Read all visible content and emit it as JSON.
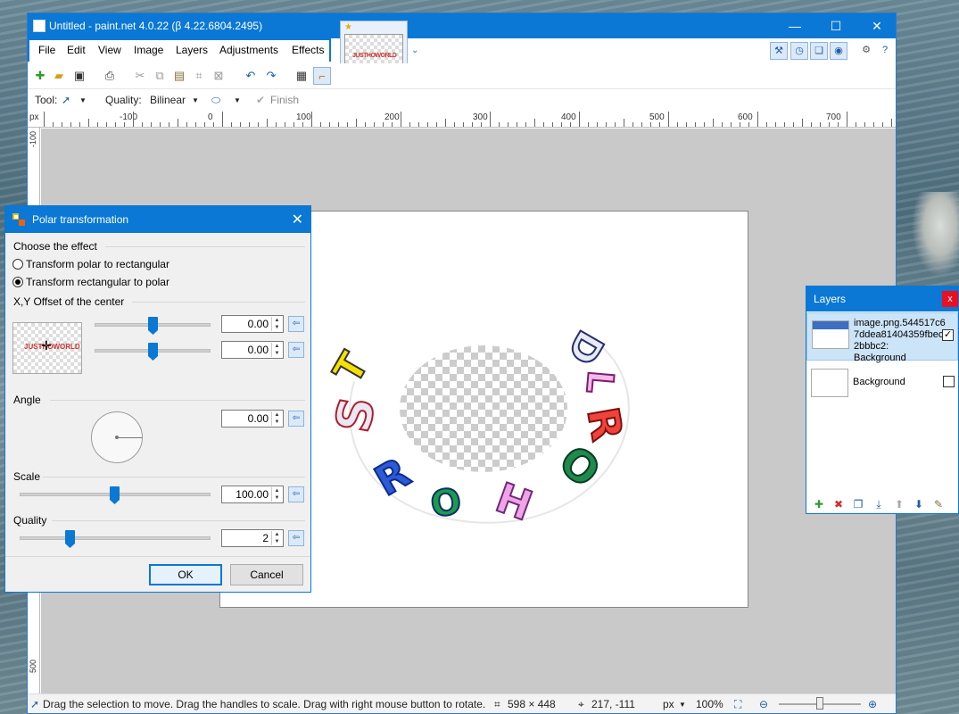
{
  "window": {
    "title": "Untitled - paint.net 4.0.22 (β 4.22.6804.2495)",
    "minimize_glyph": "—",
    "maximize_glyph": "☐",
    "close_glyph": "✕"
  },
  "menu": [
    "File",
    "Edit",
    "View",
    "Image",
    "Layers",
    "Adjustments",
    "Effects"
  ],
  "image_tab": {
    "thumb_text": "JUSTHOWORLD",
    "star": "★"
  },
  "tool_options": {
    "tool_label": "Tool:",
    "quality_label": "Quality:",
    "quality_value": "Bilinear",
    "finish_label": "Finish"
  },
  "ruler": {
    "unit": "px",
    "top_labels": [
      "-100",
      "0",
      "100",
      "200",
      "300",
      "400",
      "500",
      "600",
      "700"
    ],
    "left_labels": [
      "-100",
      "500"
    ]
  },
  "dialog": {
    "title": "Polar transformation",
    "close_glyph": "✕",
    "choose_effect_label": "Choose the effect",
    "option1": "Transform polar to rectangular",
    "option2": "Transform rectangular to polar",
    "offset_label": "X,Y Offset of the center",
    "offset_x": "0.00",
    "offset_y": "0.00",
    "angle_label": "Angle",
    "angle_value": "0.00",
    "scale_label": "Scale",
    "scale_value": "100.00",
    "quality_label": "Quality",
    "quality_value": "2",
    "ok_label": "OK",
    "cancel_label": "Cancel",
    "preview_text": "JUSTHOWORLD"
  },
  "layers": {
    "title": "Layers",
    "close_glyph": "x",
    "items": [
      {
        "name": "image.png.544517c6 7ddea81404359fbec1 2bbbc2: Background",
        "checked": true
      },
      {
        "name": "Background",
        "checked": false
      }
    ]
  },
  "status": {
    "hint": "Drag the selection to move. Drag the handles to scale. Drag with right mouse button to rotate.",
    "size": "598 × 448",
    "position": "217, -111",
    "unit": "px",
    "zoom": "100%"
  },
  "canvas_art": {
    "letters": [
      "S",
      "T",
      "R",
      "O",
      "H",
      "O",
      "R",
      "L",
      "D"
    ]
  },
  "colors": {
    "accent": "#0a78d4",
    "canvas_bg": "#c9c9c9"
  }
}
